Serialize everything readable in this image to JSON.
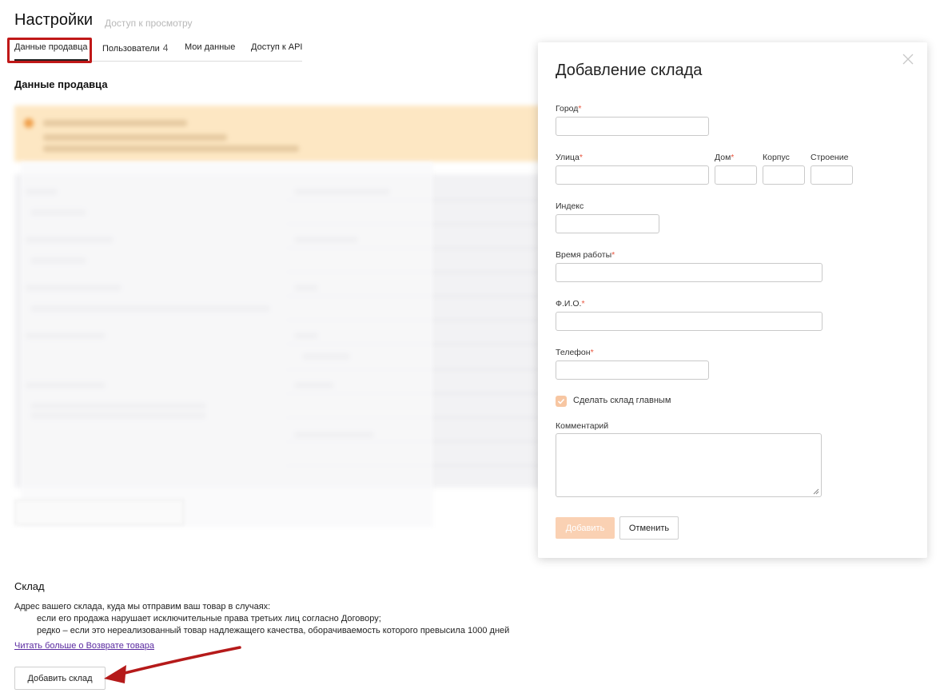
{
  "header": {
    "title": "Настройки",
    "subtitle": "Доступ к просмотру"
  },
  "tabs": [
    {
      "label": "Данные продавца",
      "active": true
    },
    {
      "label": "Пользователи",
      "count": "4"
    },
    {
      "label": "Мои данные"
    },
    {
      "label": "Доступ к API"
    }
  ],
  "seller_section": {
    "heading": "Данные продавца"
  },
  "warehouse": {
    "title": "Склад",
    "description": "Адрес вашего склада, куда мы отправим ваш товар в случаях:",
    "cases": [
      "если его продажа нарушает исключительные права третьих лиц согласно Договору;",
      "редко – если это нереализованный товар надлежащего качества, оборачиваемость которого превысила 1000 дней"
    ],
    "read_more": "Читать больше о Возврате товара",
    "add_button": "Добавить склад"
  },
  "modal": {
    "title": "Добавление склада",
    "fields": {
      "city": {
        "label": "Город",
        "required": "*"
      },
      "street": {
        "label": "Улица",
        "required": "*"
      },
      "house": {
        "label": "Дом",
        "required": "*"
      },
      "building": {
        "label": "Корпус"
      },
      "structure": {
        "label": "Строение"
      },
      "postcode": {
        "label": "Индекс"
      },
      "hours": {
        "label": "Время работы",
        "required": "*"
      },
      "name": {
        "label": "Ф.И.О.",
        "required": "*"
      },
      "phone": {
        "label": "Телефон",
        "required": "*"
      },
      "main_checkbox": {
        "label": "Сделать склад главным",
        "checked": true
      },
      "comment": {
        "label": "Комментарий"
      }
    },
    "add_button": "Добавить",
    "cancel_button": "Отменить"
  },
  "colors": {
    "accent": "#f7c6a2",
    "required": "#e8563f",
    "warning_bg": "#fde7c3",
    "highlight": "#c01818",
    "link": "#5a2aa0"
  }
}
